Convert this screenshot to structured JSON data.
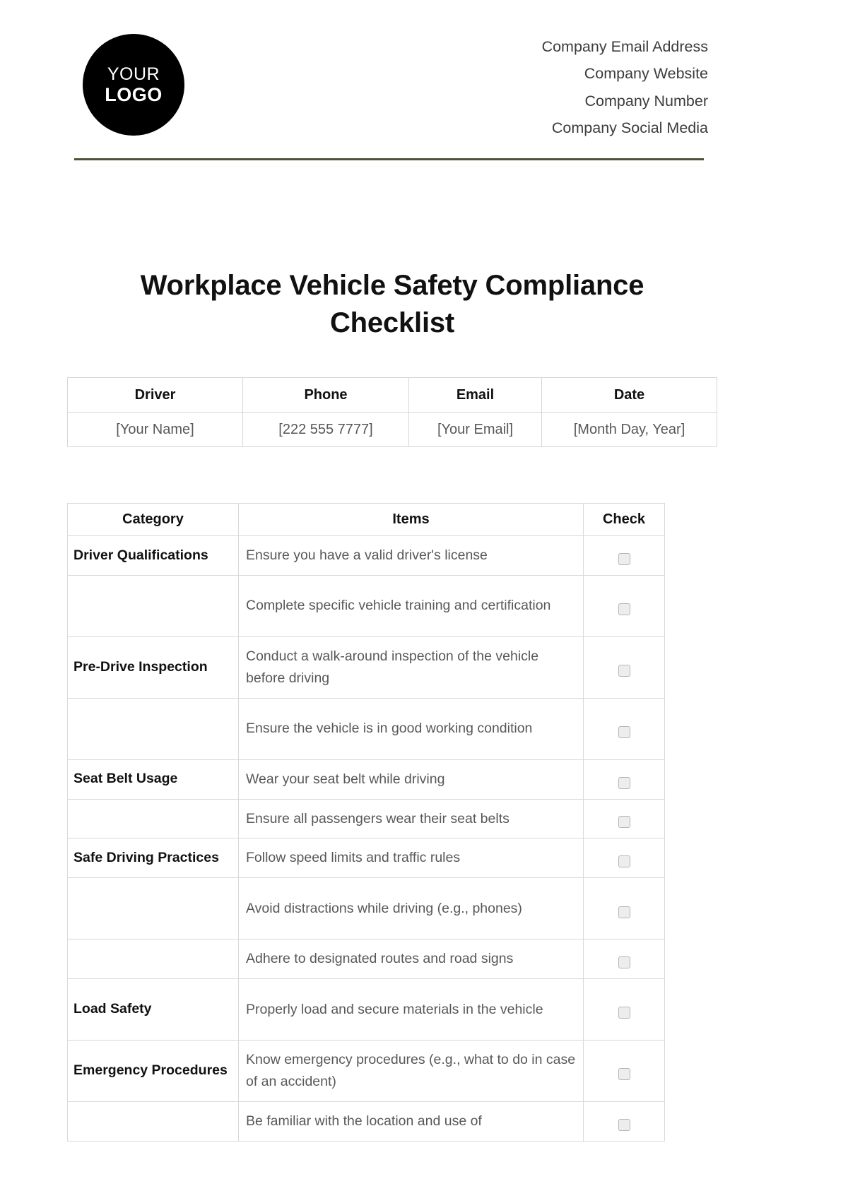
{
  "header": {
    "logo": {
      "line1": "YOUR",
      "line2": "LOGO"
    },
    "contacts": [
      "Company Email Address",
      "Company Website",
      "Company Number",
      "Company Social Media"
    ],
    "rule_color": "#4e5039"
  },
  "title": "Workplace Vehicle Safety Compliance Checklist",
  "info_table": {
    "headers": [
      "Driver",
      "Phone",
      "Email",
      "Date"
    ],
    "values": [
      "[Your Name]",
      "[222 555 7777]",
      "[Your Email]",
      "[Month Day, Year]"
    ]
  },
  "checklist": {
    "headers": [
      "Category",
      "Items",
      "Check"
    ],
    "checkbox_icon": "checkbox-unchecked",
    "rows": [
      {
        "category": "Driver Qualifications",
        "item": "Ensure you have a valid driver's license",
        "lines": 1
      },
      {
        "category": "",
        "item": "Complete specific vehicle training and certification",
        "lines": 2
      },
      {
        "category": "Pre-Drive Inspection",
        "item": "Conduct a walk-around inspection of the vehicle before driving",
        "lines": 2
      },
      {
        "category": "",
        "item": "Ensure the vehicle is in good working condition",
        "lines": 2
      },
      {
        "category": "Seat Belt Usage",
        "item": "Wear your seat belt while driving",
        "lines": 1
      },
      {
        "category": "",
        "item": "Ensure all passengers wear their seat belts",
        "lines": 1
      },
      {
        "category": "Safe Driving Practices",
        "item": "Follow speed limits and traffic rules",
        "lines": 1
      },
      {
        "category": "",
        "item": "Avoid distractions while driving (e.g., phones)",
        "lines": 2
      },
      {
        "category": "",
        "item": "Adhere to designated routes and road signs",
        "lines": 1
      },
      {
        "category": "Load Safety",
        "item": "Properly load and secure materials in the vehicle",
        "lines": 2
      },
      {
        "category": "Emergency Procedures",
        "item": "Know emergency procedures (e.g., what to do in case of an accident)",
        "lines": 2
      },
      {
        "category": "",
        "item": "Be familiar with the location and use of",
        "lines": 1
      }
    ]
  }
}
